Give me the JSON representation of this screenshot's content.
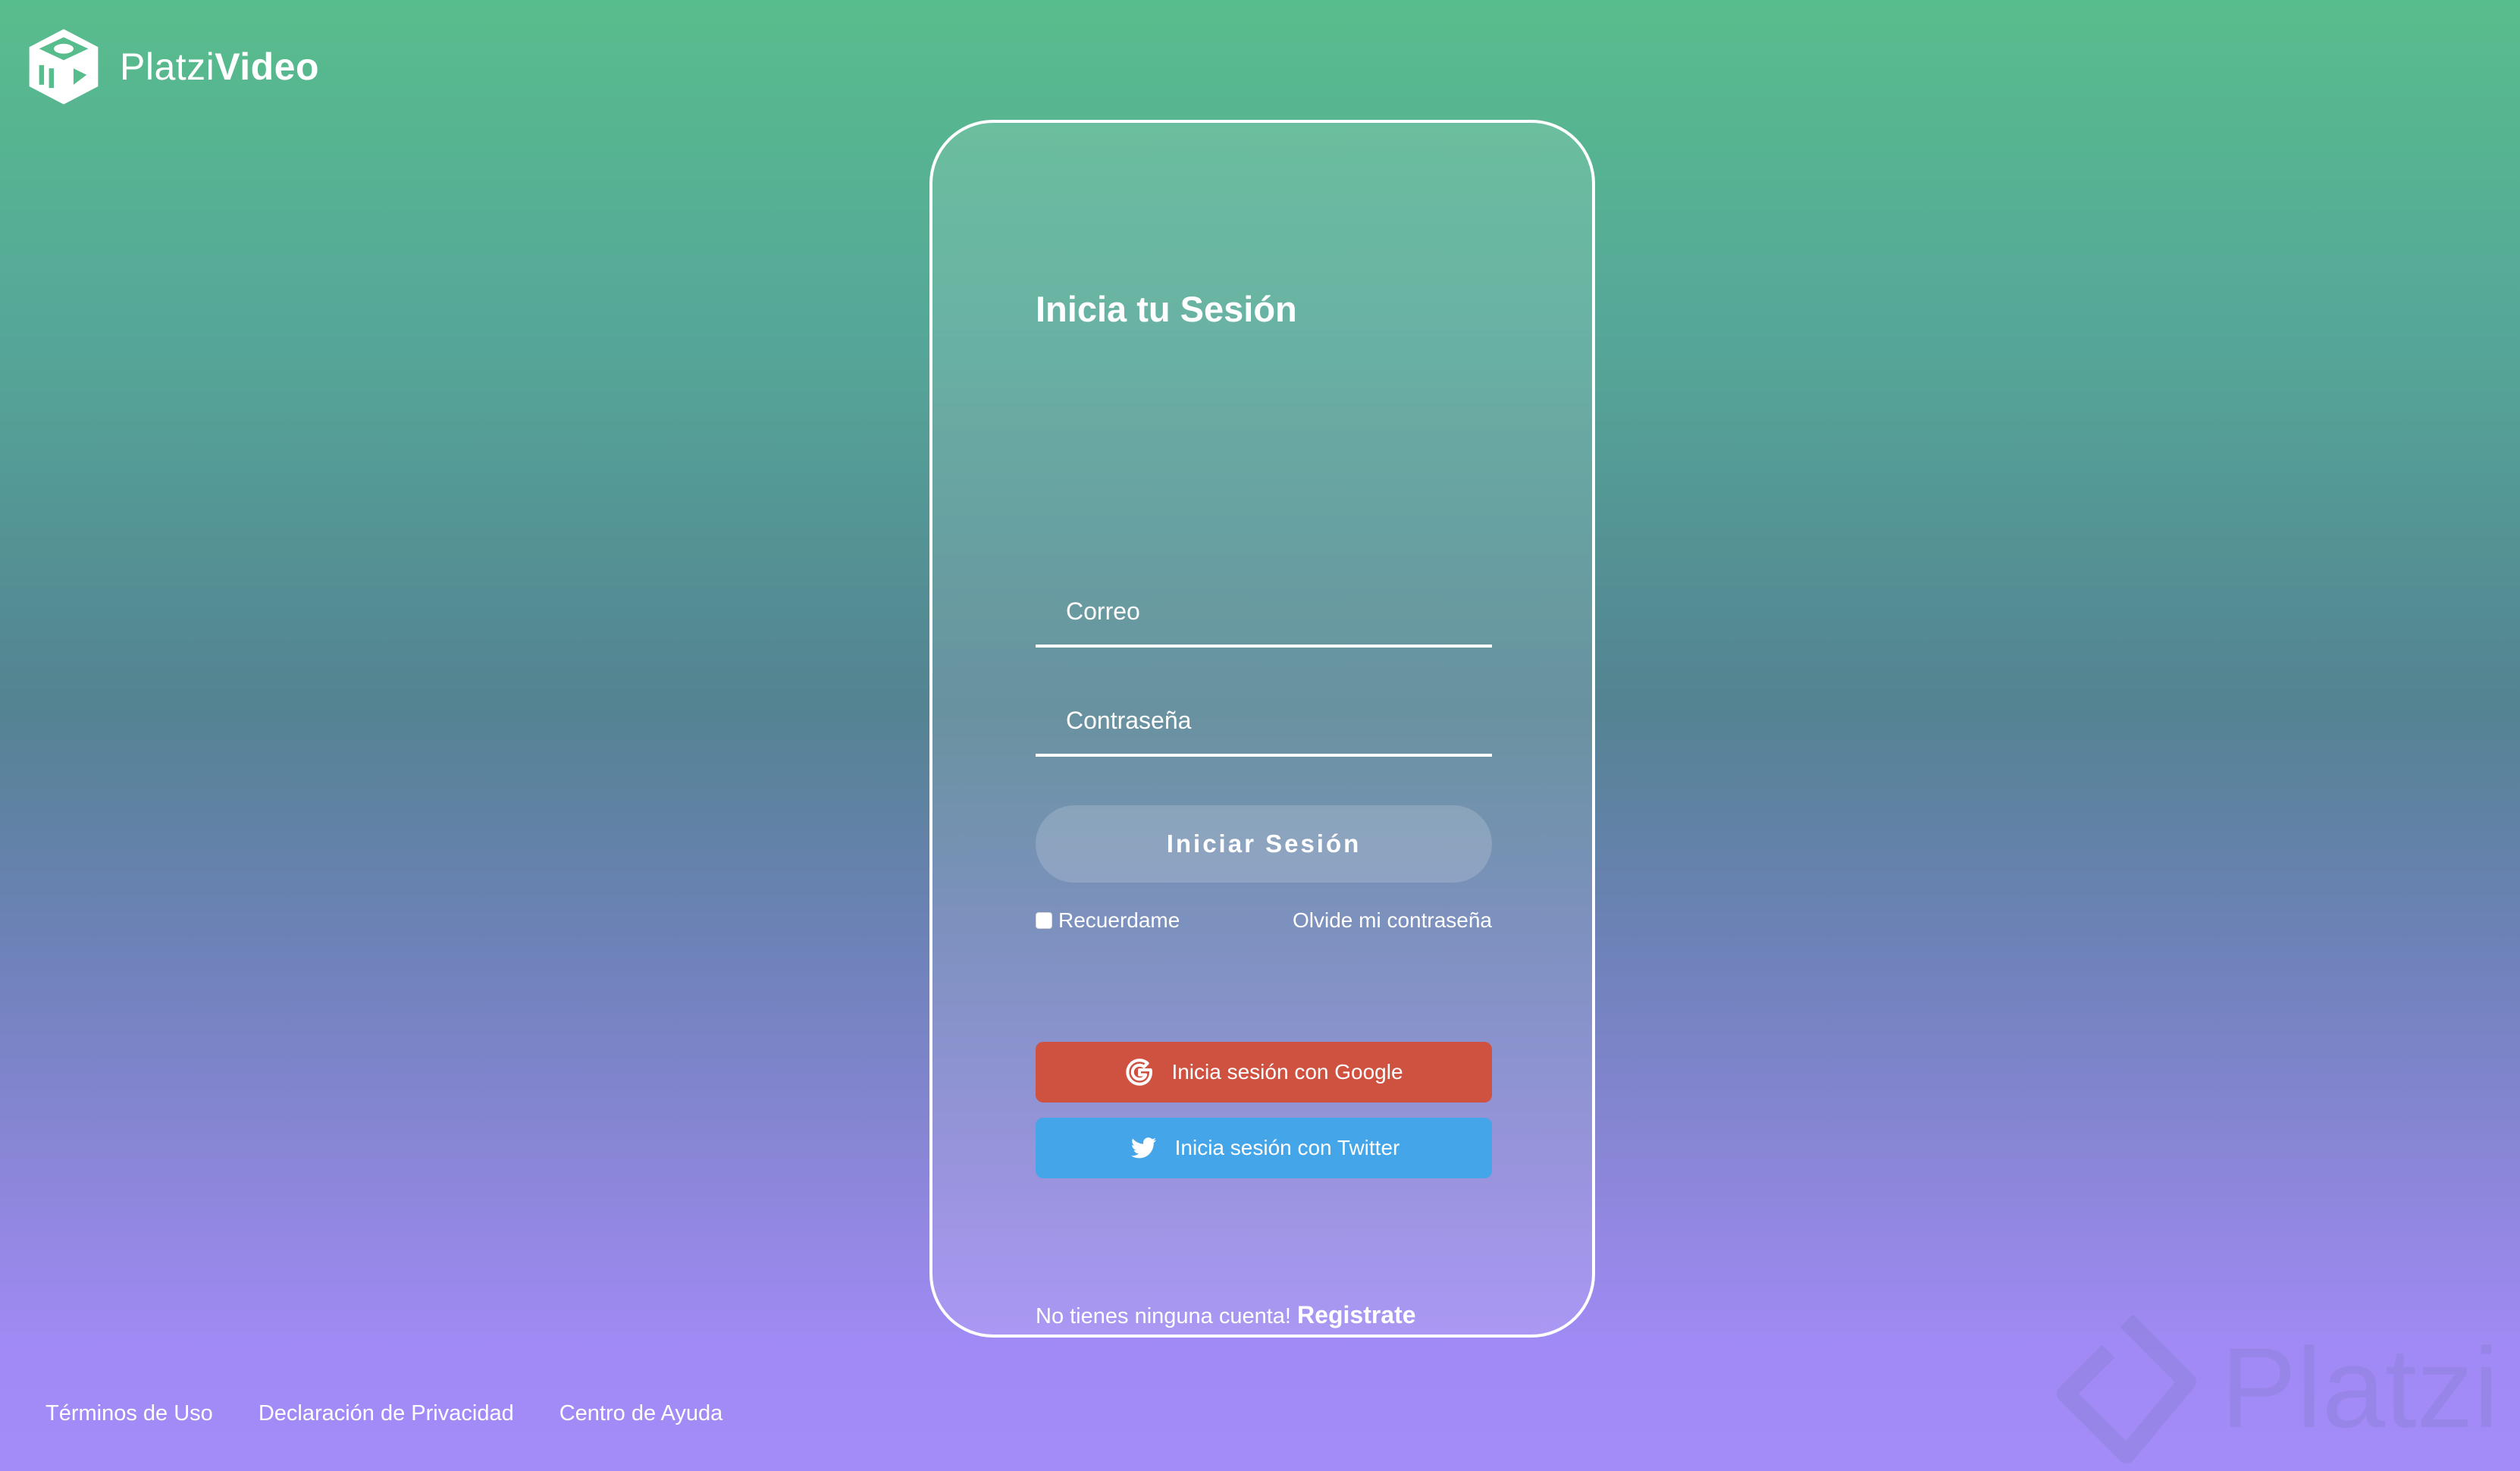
{
  "brand": {
    "name_light": "Platzi",
    "name_bold": "Video"
  },
  "login": {
    "title": "Inicia tu Sesión",
    "email_placeholder": "Correo",
    "password_placeholder": "Contraseña",
    "submit_label": "Iniciar Sesión",
    "remember_label": "Recuerdame",
    "forgot_label": "Olvide mi contraseña",
    "google_label": "Inicia sesión con Google",
    "twitter_label": "Inicia sesión con Twitter",
    "no_account_text": "No tienes ninguna cuenta!",
    "register_label": "Registrate"
  },
  "footer": {
    "links": [
      "Términos de Uso",
      "Declaración de Privacidad",
      "Centro de Ayuda"
    ]
  },
  "watermark": {
    "text": "Platzi"
  },
  "colors": {
    "google": "#cf5241",
    "twitter": "#44a6e8",
    "bg_top": "#58bd8c",
    "bg_bottom": "#a48cf8"
  },
  "icons": [
    "platzi-video-logo-icon",
    "google-icon",
    "twitter-icon",
    "platzi-watermark-icon"
  ]
}
